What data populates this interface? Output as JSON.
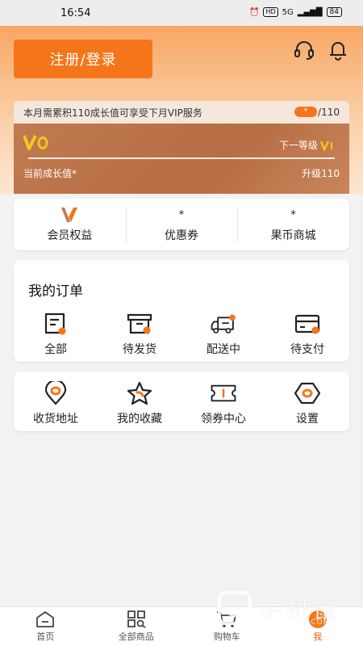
{
  "status_bar": {
    "time": "16:54",
    "hd": "HD",
    "network": "5G",
    "battery": "84"
  },
  "header": {
    "login_button": "注册/登录"
  },
  "vip": {
    "notice": "本月需累积110成长值可享受下月VIP服务",
    "progress_value": "*",
    "progress_total": "/110",
    "next_level_label": "下一等级",
    "current_growth_label": "当前成长值*",
    "upgrade_label": "升级110"
  },
  "member": {
    "items": [
      {
        "top": "",
        "label": "会员权益"
      },
      {
        "top": "*",
        "label": "优惠券"
      },
      {
        "top": "*",
        "label": "果币商城"
      }
    ]
  },
  "orders": {
    "title": "我的订单",
    "items": [
      {
        "label": "全部",
        "icon": "all-orders-icon"
      },
      {
        "label": "待发货",
        "icon": "to-ship-icon"
      },
      {
        "label": "配送中",
        "icon": "delivery-truck-icon"
      },
      {
        "label": "待支付",
        "icon": "to-pay-card-icon"
      }
    ]
  },
  "tools": {
    "items": [
      {
        "label": "收货地址",
        "icon": "location-pin-icon"
      },
      {
        "label": "我的收藏",
        "icon": "star-icon"
      },
      {
        "label": "领券中心",
        "icon": "coupon-ticket-icon"
      },
      {
        "label": "设置",
        "icon": "settings-hexagon-icon"
      }
    ]
  },
  "tabbar": {
    "items": [
      {
        "label": "首页",
        "icon": "home-icon"
      },
      {
        "label": "全部商品",
        "icon": "grid-search-icon"
      },
      {
        "label": "购物车",
        "icon": "cart-icon"
      },
      {
        "label": "我",
        "icon": "me-icon"
      }
    ]
  },
  "watermark": {
    "main": "手机鼠",
    "sub": "SHOUJISHU.COM"
  },
  "colors": {
    "accent": "#f5761a",
    "vip_card": "#b86d44",
    "active_tab": "#e8620f"
  }
}
